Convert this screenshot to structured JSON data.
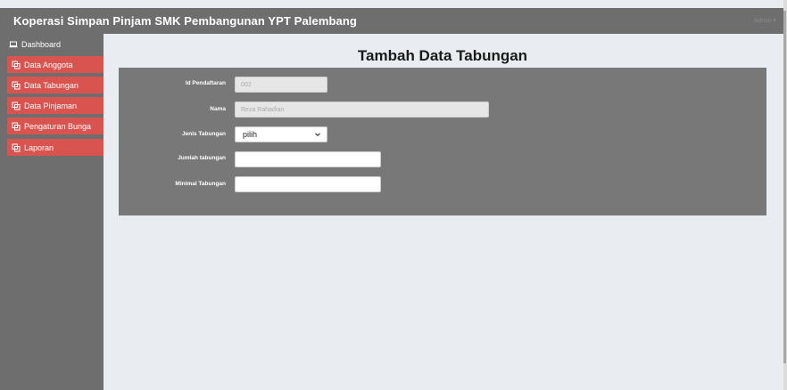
{
  "app": {
    "title": "Koperasi Simpan Pinjam SMK Pembangunan YPT Palembang",
    "user_menu": "Admin ▾"
  },
  "sidebar": {
    "items": [
      {
        "label": "Dashboard",
        "icon": "laptop-icon"
      },
      {
        "label": "Data Anggota",
        "icon": "copy-icon"
      },
      {
        "label": "Data Tabungan",
        "icon": "copy-icon"
      },
      {
        "label": "Data Pinjaman",
        "icon": "copy-icon"
      },
      {
        "label": "Pengaturan Bunga",
        "icon": "copy-icon"
      },
      {
        "label": "Laporan",
        "icon": "copy-icon"
      }
    ]
  },
  "main": {
    "title": "Tambah Data Tabungan"
  },
  "form": {
    "id_pendaftaran": {
      "label": "Id Pendaftaran",
      "value": "002"
    },
    "nama": {
      "label": "Nama",
      "value": "Reza Rahadian"
    },
    "jenis_tabungan": {
      "label": "Jenis Tabungan",
      "selected": "pilih"
    },
    "jumlah_tabungan": {
      "label": "Jumlah tabungan",
      "value": ""
    },
    "minimal_tabungan": {
      "label": "Minimal Tabungan",
      "value": ""
    }
  },
  "colors": {
    "topbar": "#6e6e6e",
    "sidebar": "#6e6e6e",
    "menu_red": "#d9534f",
    "panel": "#787878",
    "content_bg": "#e9edf1"
  }
}
